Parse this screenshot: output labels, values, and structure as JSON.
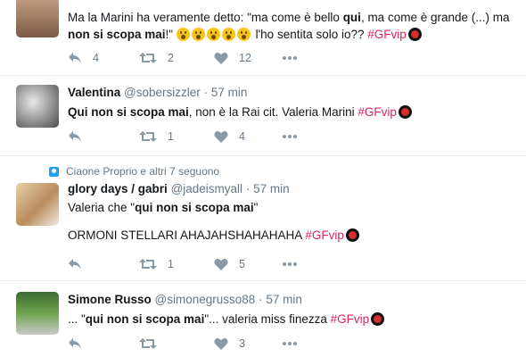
{
  "tweets": [
    {
      "text_parts": [
        "Ma la Marini ha veramente detto: \"ma come è bello ",
        "qui",
        ", ma come è grande (...) ma ",
        "non si scopa mai",
        "!\"",
        " l'ho sentita solo io?? ",
        "#GFvip"
      ],
      "emoji_count": 5,
      "reply": "",
      "retweets": "2",
      "likes": "12",
      "replies_count": "4"
    },
    {
      "name": "Valentina",
      "handle": "@sobersizzler",
      "dot": "·",
      "time": "57 min",
      "text_bold": "Qui non si scopa mai",
      "text_rest": ", non è la Rai cit. Valeria Marini ",
      "hashtag": "#GFvip",
      "retweets": "1",
      "likes": "4"
    },
    {
      "context": "Ciaone Proprio e altri 7 seguono",
      "name": "glory days / gabri",
      "handle": "@jadeismyall",
      "dot": "·",
      "time": "57 min",
      "line1_pre": "Valeria che \"",
      "line1_bold": "qui non si scopa mai",
      "line1_post": "\"",
      "line2": "ORMONI STELLARI AHAJAHSHAHAHAHA ",
      "hashtag": "#GFvip",
      "retweets": "1",
      "likes": "5"
    },
    {
      "name": "Simone Russo",
      "handle": "@simonegrusso88",
      "dot": "·",
      "time": "57 min",
      "text_pre": "... \"",
      "text_bold": "qui non si scopa mai",
      "text_post": "\"... valeria miss finezza ",
      "hashtag": "#GFvip",
      "retweets": "",
      "likes": "3"
    }
  ],
  "colors": {
    "hashtag": "#e0245e",
    "name": "#14171a",
    "meta": "#657786",
    "icon": "#8899a6",
    "context_icon": "#1da1f2"
  },
  "icons": [
    "reply-icon",
    "retweet-icon",
    "like-icon",
    "more-icon",
    "person-context-icon"
  ]
}
